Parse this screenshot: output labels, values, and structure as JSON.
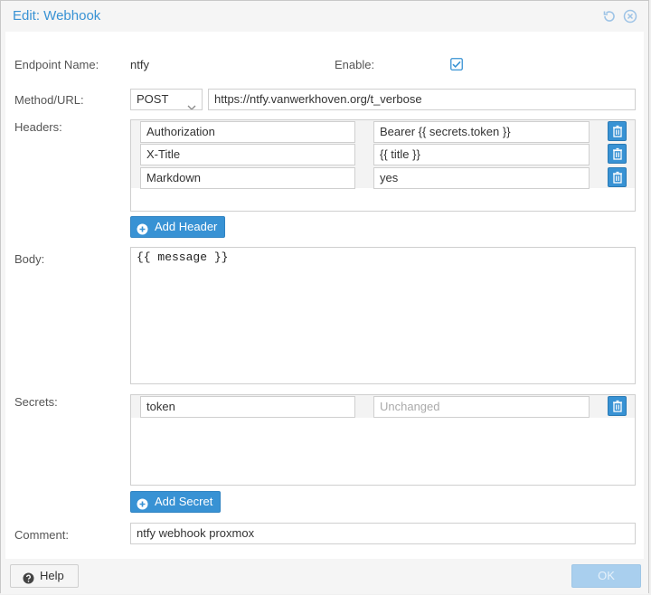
{
  "window": {
    "title": "Edit: Webhook"
  },
  "form": {
    "endpoint_label": "Endpoint Name:",
    "endpoint_value": "ntfy",
    "enable_label": "Enable:",
    "enable_checked": true,
    "method_label": "Method/URL:",
    "method_value": "POST",
    "url_value": "https://ntfy.vanwerkhoven.org/t_verbose",
    "headers_label": "Headers:",
    "headers": [
      {
        "key": "Authorization",
        "value": "Bearer {{ secrets.token }}"
      },
      {
        "key": "X-Title",
        "value": "{{ title }}"
      },
      {
        "key": "Markdown",
        "value": "yes"
      }
    ],
    "add_header_label": "Add Header",
    "body_label": "Body:",
    "body_value": "{{ message }}",
    "secrets_label": "Secrets:",
    "secrets": [
      {
        "key": "token",
        "value_placeholder": "Unchanged"
      }
    ],
    "add_secret_label": "Add Secret",
    "comment_label": "Comment:",
    "comment_value": "ntfy webhook proxmox"
  },
  "footer": {
    "help_label": "Help",
    "ok_label": "OK"
  },
  "colors": {
    "accent": "#3892d4",
    "ok_disabled": "#a9cfee"
  }
}
